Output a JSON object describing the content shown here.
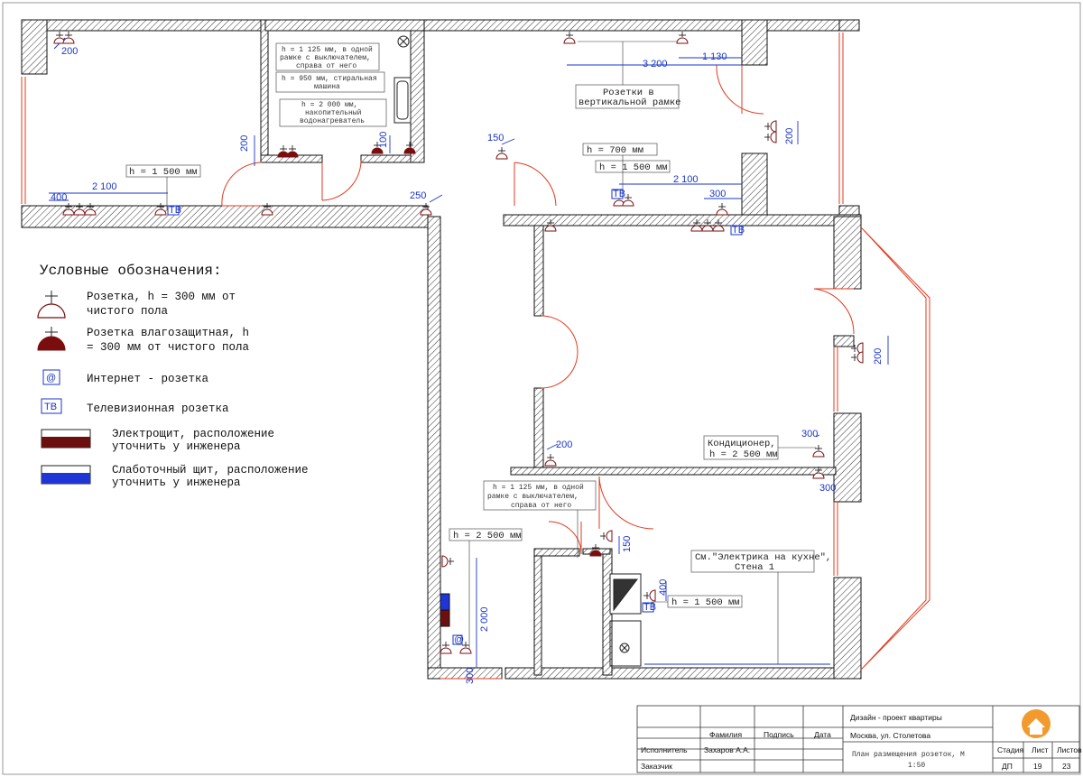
{
  "plan": {
    "dimensions": {
      "d200_a": "200",
      "d2100_a": "2 100",
      "d400": "400",
      "d200_b": "200",
      "d100": "100",
      "d150_a": "150",
      "d250": "250",
      "d3200": "3 200",
      "d1130": "1 130",
      "d2100_b": "2 100",
      "d300_a": "300",
      "d200_c": "200",
      "d200_d": "200",
      "d200_e": "200",
      "d300_b": "300",
      "d300_c": "300",
      "d150_b": "150",
      "d400_b": "400",
      "d2000": "2 000",
      "d300_d": "300"
    },
    "notes": {
      "h1500_a": "h = 1 500 мм",
      "bath_1": "h = 1 125 мм, в одной",
      "bath_2": "рамке с выключателем,",
      "bath_3": "справа от него",
      "wash_1": "h = 950 мм, стиральная",
      "wash_2": "машина",
      "heat_1": "h = 2 000 мм,",
      "heat_2": "накопительный",
      "heat_3": "водонагреватель",
      "vert_1": "Розетки в",
      "vert_2": "вертикальной рамке",
      "h700": "h = 700 мм",
      "h1500_b": "h = 1 500 мм",
      "ac_1": "Кондиционер,",
      "ac_2": "h = 2 500 мм",
      "hall_1": "h = 1 125 мм, в одной",
      "hall_2": "рамке с выключателем,",
      "hall_3": "справа от него",
      "h2500": "h = 2 500 мм",
      "kitchen_1": "См.\"Электрика на кухне\",",
      "kitchen_2": "Стена 1",
      "h1500_c": "h = 1 500 мм"
    },
    "tv_tag": "ТВ",
    "net_tag": "@"
  },
  "legend": {
    "title": "Условные обозначения:",
    "socket_1": "Розетка, h = 300 мм от",
    "socket_2": "чистого пола",
    "wet_1": "Розетка влагозащитная, h",
    "wet_2": "= 300 мм от чистого пола",
    "internet": "Интернет - розетка",
    "tv": "Телевизионная розетка",
    "panel_1": "Электрощит, расположение",
    "panel_2": "уточнить у инженера",
    "low_1": "Слаботочный щит, расположение",
    "low_2": "уточнить у инженера",
    "icon_net": "@",
    "icon_tv": "ТВ",
    "colors": {
      "panel": "#6b0f0f",
      "low_current": "#1f35d6"
    }
  },
  "title_block": {
    "project": "Дизайн - проект квартиры",
    "address": "Москва, ул. Столетова",
    "col_name": "Фамилия",
    "col_sign": "Подпись",
    "col_date": "Дата",
    "role_exec": "Исполнитель",
    "exec_name": "Захаров А.А.",
    "role_client": "Заказчик",
    "sheet_title_1": "План размещения розеток, М",
    "sheet_title_2": "1:50",
    "stage_label": "Стадия",
    "sheet_label": "Лист",
    "sheets_label": "Листов",
    "stage": "ДП",
    "sheet": "19",
    "sheets": "23"
  },
  "colors": {
    "wall": "#111111",
    "door": "#e03a1e",
    "dimension": "#1a36c8",
    "wet": "#7a0e0e"
  }
}
